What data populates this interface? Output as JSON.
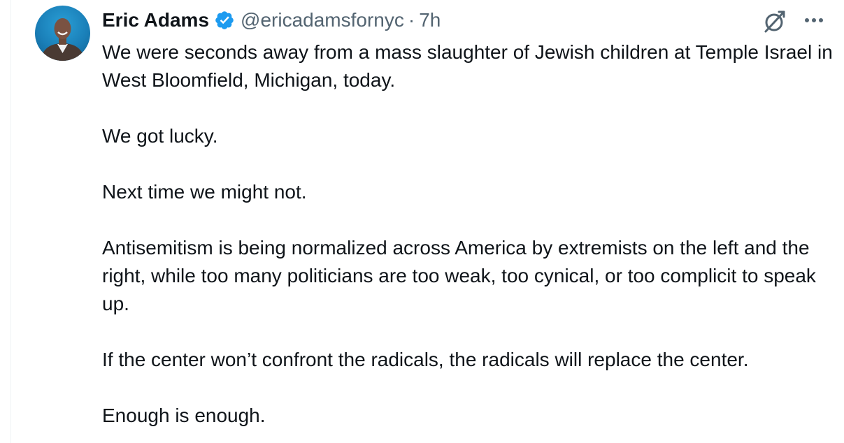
{
  "author": {
    "display_name": "Eric Adams",
    "handle": "@ericadamsfornyc",
    "separator": "·",
    "time": "7h",
    "verified_color": "#1d9bf0"
  },
  "icons": {
    "avatar": "profile-photo",
    "verified": "verified-badge-icon",
    "grok": "grok-icon",
    "more": "more-options-icon"
  },
  "tweet": {
    "paragraphs": [
      "We were seconds away from a mass slaughter of Jewish children at Temple Israel in West Bloomfield, Michigan, today.",
      "We got lucky.",
      "Next time we might not.",
      "Antisemitism is being normalized across America by extremists on the left and the right, while too many politicians are too weak, too cynical, or too complicit to speak up.",
      "If the center won’t confront the radicals, the radicals will replace the center.",
      "Enough is enough."
    ]
  }
}
